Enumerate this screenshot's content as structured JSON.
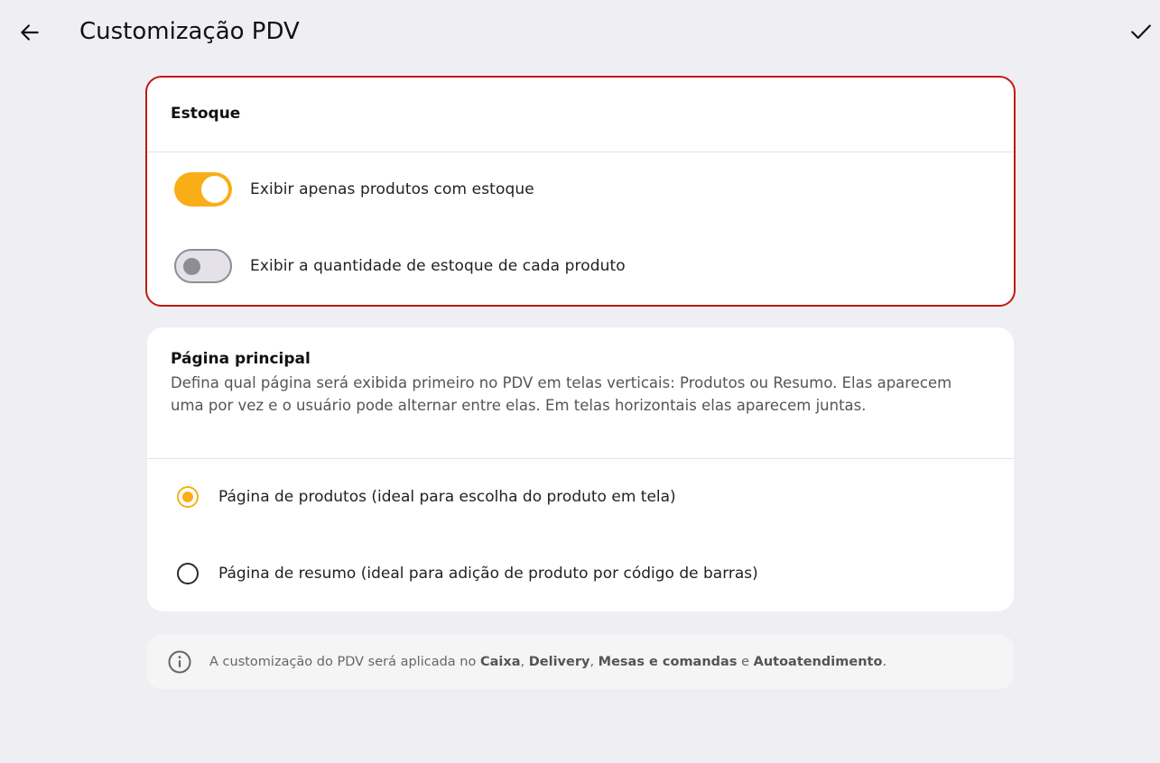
{
  "header": {
    "title": "Customização PDV",
    "back_icon": "arrow-left-icon",
    "confirm_icon": "check-icon"
  },
  "stock_card": {
    "title": "Estoque",
    "options": [
      {
        "label": "Exibir apenas produtos com estoque",
        "enabled": true
      },
      {
        "label": "Exibir a quantidade de estoque de cada produto",
        "enabled": false
      }
    ]
  },
  "main_page_card": {
    "title": "Página principal",
    "description": "Defina qual página será exibida primeiro no PDV em telas verticais: Produtos ou Resumo. Elas aparecem uma por vez e o usuário pode alternar entre elas. Em telas horizontais elas aparecem juntas.",
    "options": [
      {
        "label": "Página de produtos (ideal para escolha do produto em tela)",
        "selected": true
      },
      {
        "label": "Página de resumo (ideal para adição de produto por código de barras)",
        "selected": false
      }
    ]
  },
  "info": {
    "icon": "info-icon",
    "prefix": "A customização do PDV será aplicada no ",
    "item1": "Caixa",
    "sep1": ", ",
    "item2": "Delivery",
    "sep2": ", ",
    "item3": "Mesas e comandas",
    "sep3": " e ",
    "item4": "Autoatendimento",
    "suffix": "."
  },
  "colors": {
    "accent": "#f9ae17",
    "highlight_border": "#c4180f",
    "background": "#efeff3"
  }
}
